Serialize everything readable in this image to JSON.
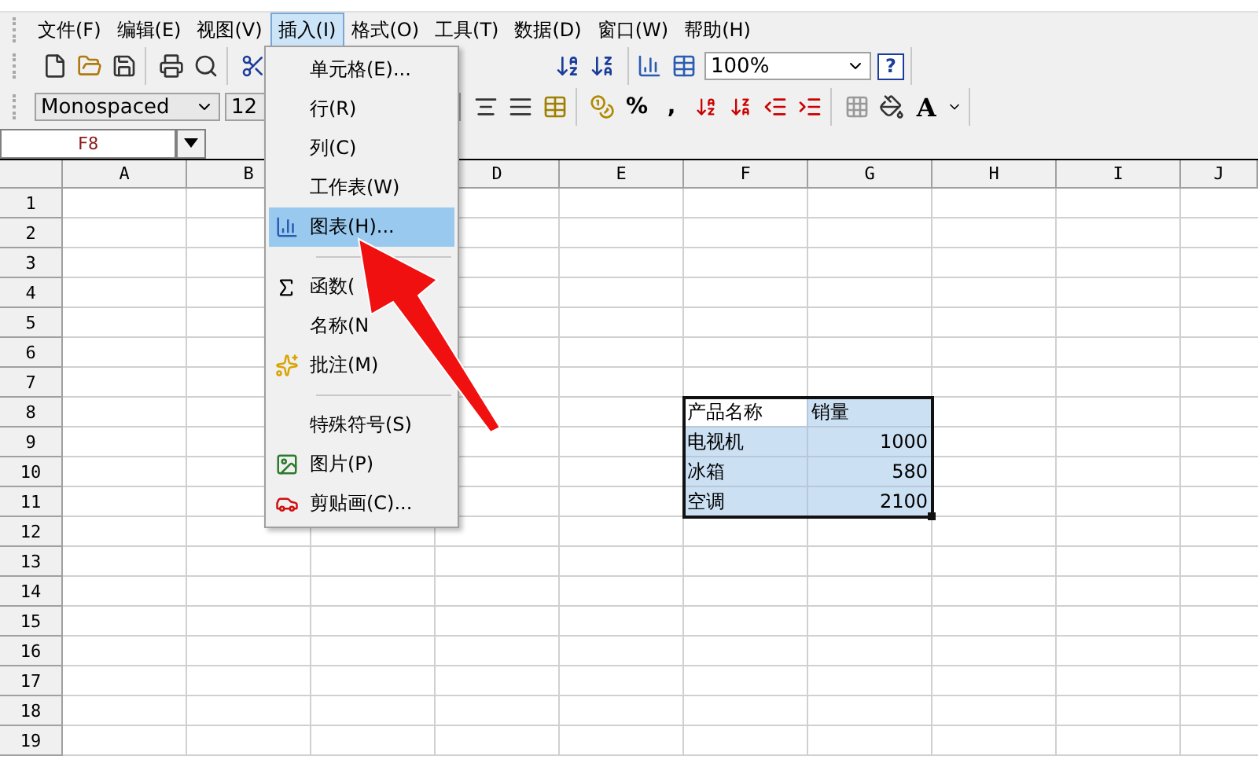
{
  "menu_bar": [
    {
      "label": "文件(F)",
      "selected": false
    },
    {
      "label": "编辑(E)",
      "selected": false
    },
    {
      "label": "视图(V)",
      "selected": false
    },
    {
      "label": "插入(I)",
      "selected": true
    },
    {
      "label": "格式(O)",
      "selected": false
    },
    {
      "label": "工具(T)",
      "selected": false
    },
    {
      "label": "数据(D)",
      "selected": false
    },
    {
      "label": "窗口(W)",
      "selected": false
    },
    {
      "label": "帮助(H)",
      "selected": false
    }
  ],
  "standard_toolbar": {
    "zoom": "100%",
    "help_glyph": "?"
  },
  "format_toolbar": {
    "font": "Monospaced",
    "size": "12",
    "glyph_buttons": [
      "%",
      ","
    ],
    "font_color_glyph": "A"
  },
  "name_box": "F8",
  "insert_menu": [
    {
      "kind": "item",
      "label": "单元格(E)...",
      "selected": false
    },
    {
      "kind": "item",
      "label": "行(R)",
      "selected": false
    },
    {
      "kind": "item",
      "label": "列(C)",
      "selected": false
    },
    {
      "kind": "item",
      "label": "工作表(W)",
      "selected": false
    },
    {
      "kind": "item",
      "label": "图表(H)...",
      "selected": true
    },
    {
      "kind": "separator"
    },
    {
      "kind": "item",
      "label": "函数(",
      "selected": false
    },
    {
      "kind": "item",
      "label": "名称(N",
      "selected": false
    },
    {
      "kind": "item",
      "label": "批注(M)",
      "selected": false
    },
    {
      "kind": "separator"
    },
    {
      "kind": "item",
      "label": "特殊符号(S)",
      "selected": false
    },
    {
      "kind": "item",
      "label": "图片(P)",
      "selected": false
    },
    {
      "kind": "item",
      "label": "剪贴画(C)...",
      "selected": false
    }
  ],
  "sheet": {
    "columns": [
      "A",
      "B",
      null,
      "D",
      "E",
      "F",
      "G",
      "H",
      "I",
      "J"
    ],
    "rows": [
      {
        "label": "1"
      },
      {
        "label": "2"
      },
      {
        "label": "3"
      },
      {
        "label": "4"
      },
      {
        "label": "5"
      },
      {
        "label": "6"
      },
      {
        "label": "7"
      },
      {
        "label": "8",
        "cells": [
          null,
          null,
          null,
          null,
          null,
          {
            "kind": "text",
            "text": "产品名称",
            "selected": false
          },
          {
            "kind": "text",
            "text": "销量",
            "selected": true
          }
        ]
      },
      {
        "label": "9",
        "cells": [
          null,
          null,
          null,
          null,
          null,
          {
            "kind": "text",
            "text": "电视机",
            "selected": true
          },
          {
            "kind": "number",
            "text": "1000",
            "selected": true
          }
        ]
      },
      {
        "label": "10",
        "cells": [
          null,
          null,
          null,
          null,
          null,
          {
            "kind": "text",
            "text": "冰箱",
            "selected": true
          },
          {
            "kind": "number",
            "text": "580",
            "selected": true
          }
        ]
      },
      {
        "label": "11",
        "cells": [
          null,
          null,
          null,
          null,
          null,
          {
            "kind": "text",
            "text": "空调",
            "selected": true
          },
          {
            "kind": "number",
            "text": "2100",
            "selected": true
          }
        ]
      },
      {
        "label": "12"
      },
      {
        "label": "13"
      },
      {
        "label": "14"
      },
      {
        "label": "15"
      },
      {
        "label": "16"
      },
      {
        "label": "17"
      },
      {
        "label": "18"
      },
      {
        "label": "19"
      }
    ]
  }
}
